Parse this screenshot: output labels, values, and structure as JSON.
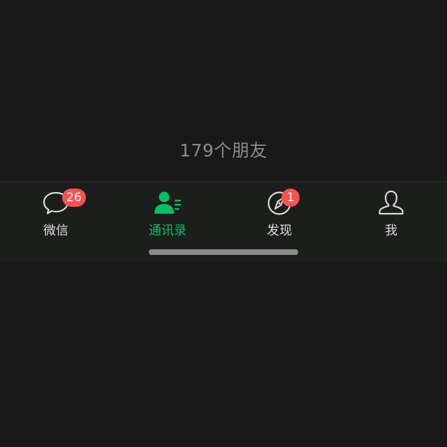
{
  "contacts": {
    "friend_count_text": "179个朋友"
  },
  "tabbar": {
    "tabs": [
      {
        "label": "微信",
        "icon": "chat-bubble-icon",
        "badge": "26",
        "active": false
      },
      {
        "label": "通讯录",
        "icon": "contacts-icon",
        "badge": null,
        "active": true
      },
      {
        "label": "发现",
        "icon": "compass-icon",
        "badge": "1",
        "active": false
      },
      {
        "label": "我",
        "icon": "person-icon",
        "badge": null,
        "active": false
      }
    ]
  },
  "colors": {
    "background": "#191919",
    "tabbar_background": "#1c1e1c",
    "active": "#07c160",
    "inactive": "#dcdcdc",
    "badge": "#fa5151",
    "muted_text": "#8a8a8a"
  }
}
